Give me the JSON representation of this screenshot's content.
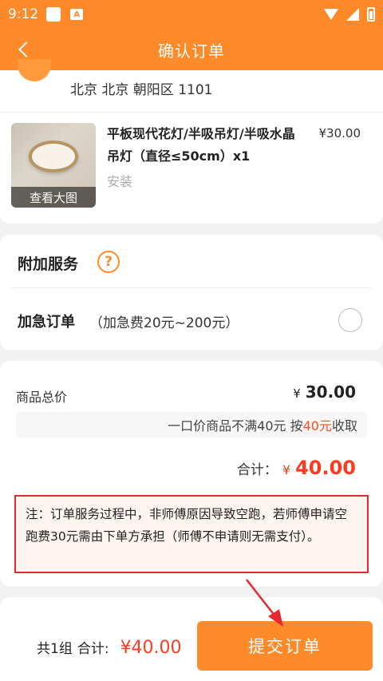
{
  "status_bar": {
    "time": "9:12",
    "notification_badge": "A"
  },
  "header": {
    "title": "确认订单"
  },
  "address": {
    "text": "北京 北京 朝阳区 1101"
  },
  "product": {
    "name": "平板现代花灯/半吸吊灯/半吸水晶吊灯（直径≤50cm）x1",
    "price": "¥30.00",
    "service_type": "安装",
    "view_large_label": "查看大图"
  },
  "extra_services": {
    "title": "附加服务",
    "help_symbol": "?",
    "urgent_label": "加急订单",
    "urgent_note": "（加急费20元~200元）",
    "urgent_selected": false
  },
  "pricing": {
    "goods_total_label": "商品总价",
    "goods_total_currency": "¥",
    "goods_total_value": "30.00",
    "fixed_note_prefix": "一口价商品不满40元 按",
    "fixed_note_highlight": "40元",
    "fixed_note_suffix": "收取",
    "total_label": "合计：",
    "total_currency": "¥",
    "total_value": "40.00",
    "warning": "注：订单服务过程中，非师傅原因导致空跑，若师傅申请空跑费30元需由下单方承担（师傅不申请则无需支付）。"
  },
  "bottom_bar": {
    "count_label": "共1组",
    "total_label": "合计:",
    "total_amount": "¥40.00",
    "submit_label": "提交订单"
  },
  "colors": {
    "brand_orange": "#ff8a2a",
    "price_red": "#ff3b1f",
    "annotation_red": "#e8282c"
  }
}
